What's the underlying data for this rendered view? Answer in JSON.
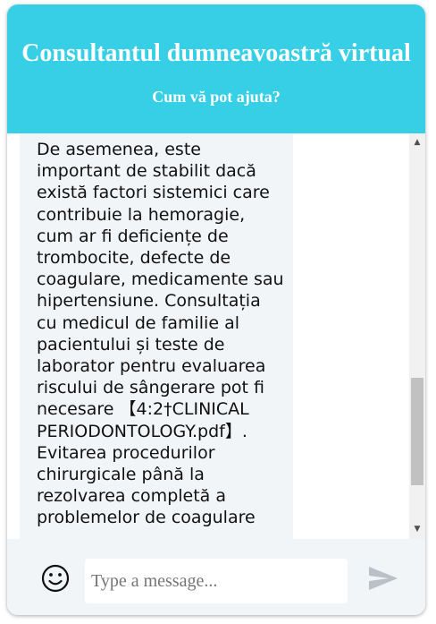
{
  "header": {
    "title": "Consultantul dumneavoastră virtual",
    "subtitle": "Cum vă pot ajuta?"
  },
  "message": {
    "text": "De asemenea, este important de stabilit dacă există factori sistemici care contribuie la hemoragie, cum ar fi deficiențe de trombocite, defecte de coagulare, medicamente sau hipertensiune. Consultația cu medicul de familie al pacientului și teste de laborator pentru evaluarea riscului de sângerare pot fi necesare 【4:2†CLINICAL PERIODONTOLOGY.pdf】. Evitarea procedurilor chirurgicale până la rezolvarea completă a problemelor de coagulare"
  },
  "composer": {
    "placeholder": "Type a message...",
    "value": "",
    "emoji_icon": "smiley-face-icon",
    "send_icon": "paper-plane-send-icon"
  },
  "colors": {
    "header_bg": "#36cfe6",
    "header_text": "#ffffff",
    "bubble_bg": "#f2f5f8",
    "footer_bg": "#f2f5f8",
    "send_icon": "#b9c0c7"
  }
}
